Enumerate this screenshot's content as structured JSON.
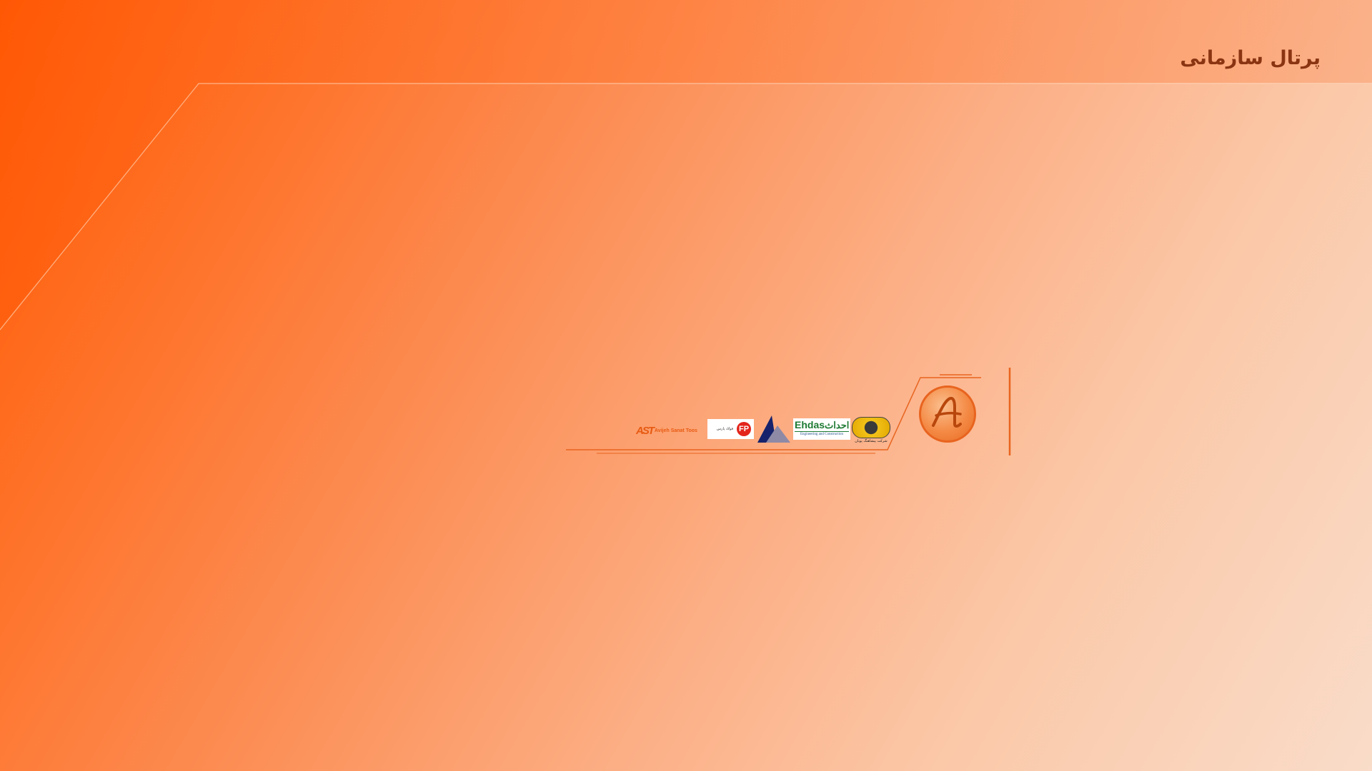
{
  "header": {
    "title": "پرتال سازمانی"
  },
  "logos": {
    "main_emblem_letter": "A",
    "globe_caption": "شرکت پیشاهنگ پویان",
    "ehdas_latin": "Ehdas",
    "ehdas_farsi": "احداث",
    "ehdas_subtitle": "Engineering and Construction",
    "fp_farsi": "فولاد پارس",
    "fp_mark": "FP",
    "avijeh_mark": "AST",
    "avijeh_name": "Avijeh Sanat Toos"
  },
  "colors": {
    "accent": "#e8641f",
    "title": "#8a3412"
  }
}
